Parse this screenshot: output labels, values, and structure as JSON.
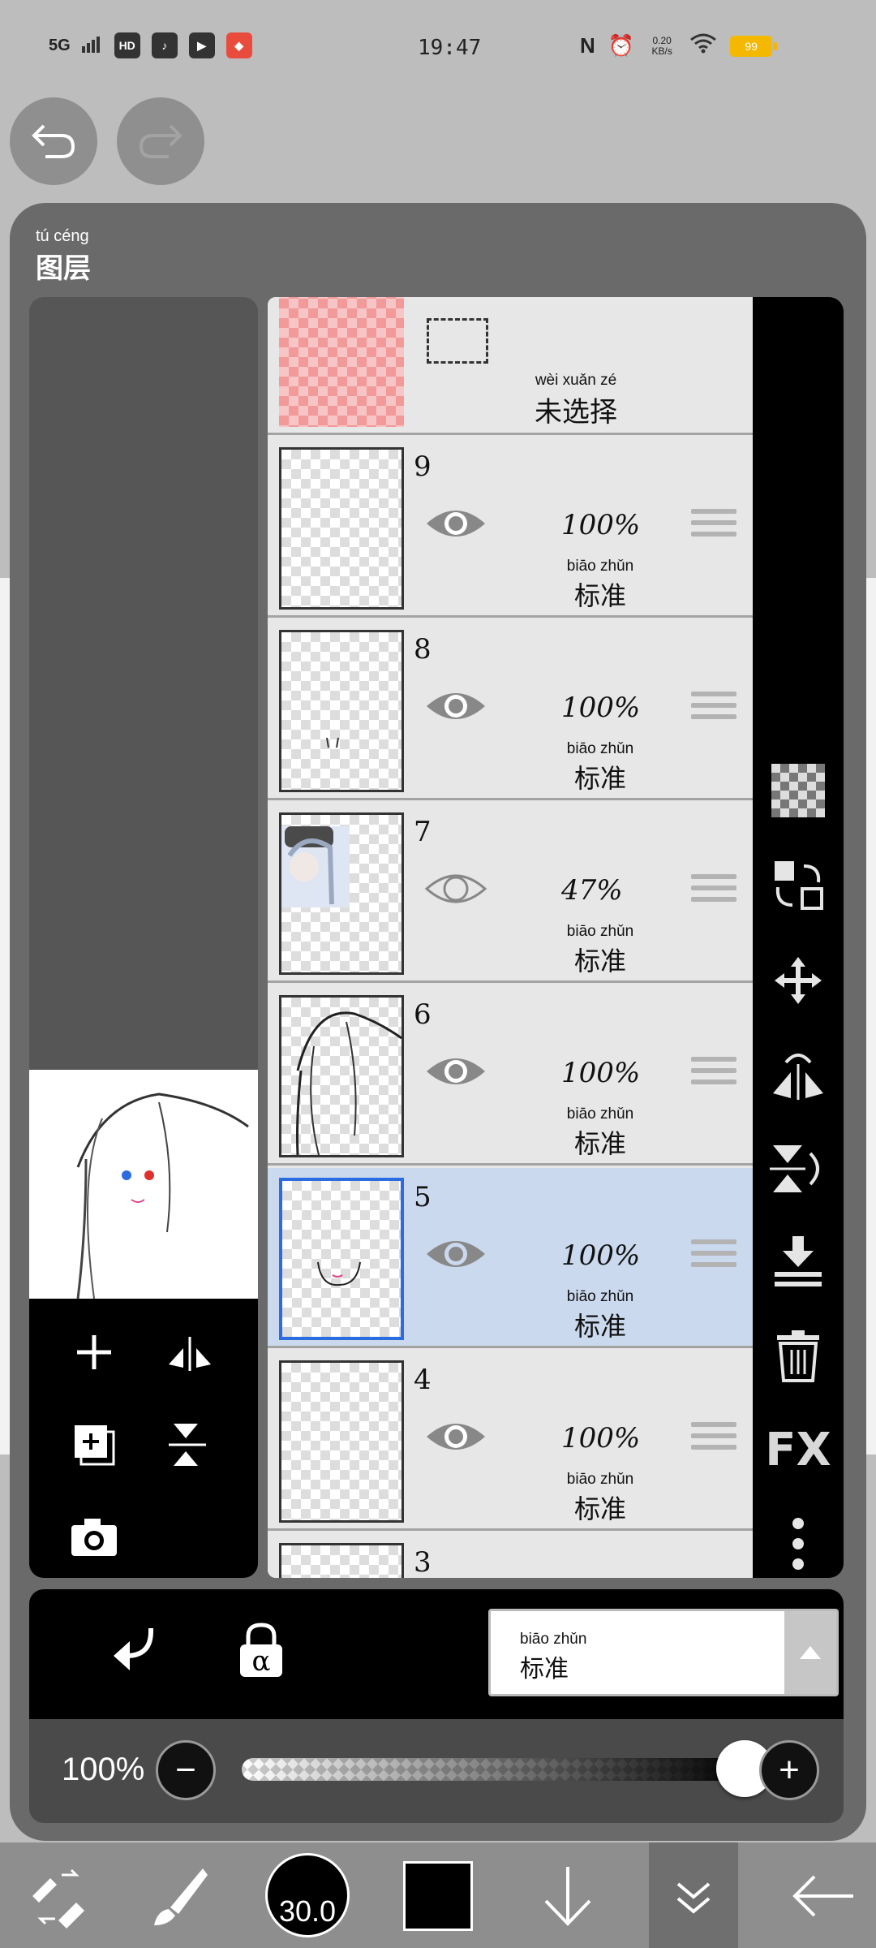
{
  "status_bar": {
    "network": "5G",
    "hd": "HD",
    "time": "19:47",
    "speed_value": "0.20",
    "speed_unit": "KB/s",
    "battery": "99"
  },
  "panel": {
    "title_pinyin": "tú céng",
    "title": "图层"
  },
  "clip_layer": {
    "status_pinyin": "wèi xuǎn zé",
    "status": "未选择"
  },
  "layers": [
    {
      "number": "9",
      "opacity": "100%",
      "blend_pinyin": "biāo zhǔn",
      "blend": "标准",
      "visible": true,
      "selected": false
    },
    {
      "number": "8",
      "opacity": "100%",
      "blend_pinyin": "biāo zhǔn",
      "blend": "标准",
      "visible": true,
      "selected": false
    },
    {
      "number": "7",
      "opacity": "47%",
      "blend_pinyin": "biāo zhǔn",
      "blend": "标准",
      "visible": false,
      "selected": false
    },
    {
      "number": "6",
      "opacity": "100%",
      "blend_pinyin": "biāo zhǔn",
      "blend": "标准",
      "visible": true,
      "selected": false
    },
    {
      "number": "5",
      "opacity": "100%",
      "blend_pinyin": "biāo zhǔn",
      "blend": "标准",
      "visible": true,
      "selected": true
    },
    {
      "number": "4",
      "opacity": "100%",
      "blend_pinyin": "biāo zhǔn",
      "blend": "标准",
      "visible": true,
      "selected": false
    },
    {
      "number": "3"
    }
  ],
  "right_tools": {
    "fx_label": "FX"
  },
  "blend_mode": {
    "pinyin": "biāo zhǔn",
    "label": "标准"
  },
  "opacity": {
    "label": "100%",
    "value": 1.0,
    "minus": "−",
    "plus": "+"
  },
  "toolbar": {
    "brush_size": "30.0"
  },
  "colors": {
    "selected_row": "#cbd9ef",
    "selected_border": "#2b6de0",
    "panel_bg": "#6a6a6a",
    "battery": "#f5b800"
  }
}
